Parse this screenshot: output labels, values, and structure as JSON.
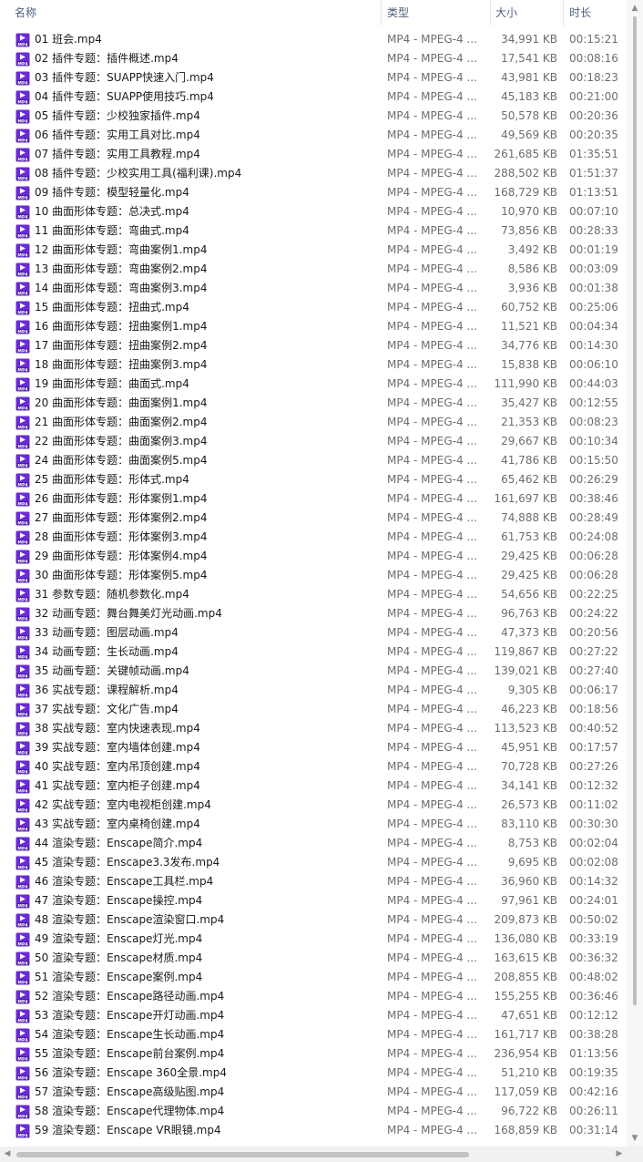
{
  "columns": {
    "name": "名称",
    "type": "类型",
    "size": "大小",
    "duration": "时长"
  },
  "icon": "mp4-file-icon",
  "icon_label": "MP4",
  "icon_color": "#6a2bd6",
  "files": [
    {
      "name": "01 班会.mp4",
      "type": "MP4 - MPEG-4 ...",
      "size": "34,991 KB",
      "duration": "00:15:21"
    },
    {
      "name": "02 插件专题：插件概述.mp4",
      "type": "MP4 - MPEG-4 ...",
      "size": "17,541 KB",
      "duration": "00:08:16"
    },
    {
      "name": "03 插件专题：SUAPP快速入门.mp4",
      "type": "MP4 - MPEG-4 ...",
      "size": "43,981 KB",
      "duration": "00:18:23"
    },
    {
      "name": "04 插件专题：SUAPP使用技巧.mp4",
      "type": "MP4 - MPEG-4 ...",
      "size": "45,183 KB",
      "duration": "00:21:00"
    },
    {
      "name": "05 插件专题：少校独家插件.mp4",
      "type": "MP4 - MPEG-4 ...",
      "size": "50,578 KB",
      "duration": "00:20:36"
    },
    {
      "name": "06 插件专题：实用工具对比.mp4",
      "type": "MP4 - MPEG-4 ...",
      "size": "49,569 KB",
      "duration": "00:20:35"
    },
    {
      "name": "07 插件专题：实用工具教程.mp4",
      "type": "MP4 - MPEG-4 ...",
      "size": "261,685 KB",
      "duration": "01:35:51"
    },
    {
      "name": "08 插件专题：少校实用工具(福利课).mp4",
      "type": "MP4 - MPEG-4 ...",
      "size": "288,502 KB",
      "duration": "01:51:37"
    },
    {
      "name": "09 插件专题：模型轻量化.mp4",
      "type": "MP4 - MPEG-4 ...",
      "size": "168,729 KB",
      "duration": "01:13:51"
    },
    {
      "name": "10 曲面形体专题：总决式.mp4",
      "type": "MP4 - MPEG-4 ...",
      "size": "10,970 KB",
      "duration": "00:07:10"
    },
    {
      "name": "11 曲面形体专题：弯曲式.mp4",
      "type": "MP4 - MPEG-4 ...",
      "size": "73,856 KB",
      "duration": "00:28:33"
    },
    {
      "name": "12 曲面形体专题：弯曲案例1.mp4",
      "type": "MP4 - MPEG-4 ...",
      "size": "3,492 KB",
      "duration": "00:01:19"
    },
    {
      "name": "13 曲面形体专题：弯曲案例2.mp4",
      "type": "MP4 - MPEG-4 ...",
      "size": "8,586 KB",
      "duration": "00:03:09"
    },
    {
      "name": "14 曲面形体专题：弯曲案例3.mp4",
      "type": "MP4 - MPEG-4 ...",
      "size": "3,936 KB",
      "duration": "00:01:38"
    },
    {
      "name": "15 曲面形体专题：扭曲式.mp4",
      "type": "MP4 - MPEG-4 ...",
      "size": "60,752 KB",
      "duration": "00:25:06"
    },
    {
      "name": "16 曲面形体专题：扭曲案例1.mp4",
      "type": "MP4 - MPEG-4 ...",
      "size": "11,521 KB",
      "duration": "00:04:34"
    },
    {
      "name": "17 曲面形体专题：扭曲案例2.mp4",
      "type": "MP4 - MPEG-4 ...",
      "size": "34,776 KB",
      "duration": "00:14:30"
    },
    {
      "name": "18 曲面形体专题：扭曲案例3.mp4",
      "type": "MP4 - MPEG-4 ...",
      "size": "15,838 KB",
      "duration": "00:06:10"
    },
    {
      "name": "19 曲面形体专题：曲面式.mp4",
      "type": "MP4 - MPEG-4 ...",
      "size": "111,990 KB",
      "duration": "00:44:03"
    },
    {
      "name": "20 曲面形体专题：曲面案例1.mp4",
      "type": "MP4 - MPEG-4 ...",
      "size": "35,427 KB",
      "duration": "00:12:55"
    },
    {
      "name": "21 曲面形体专题：曲面案例2.mp4",
      "type": "MP4 - MPEG-4 ...",
      "size": "21,353 KB",
      "duration": "00:08:23"
    },
    {
      "name": "22 曲面形体专题：曲面案例3.mp4",
      "type": "MP4 - MPEG-4 ...",
      "size": "29,667 KB",
      "duration": "00:10:34"
    },
    {
      "name": "24 曲面形体专题：曲面案例5.mp4",
      "type": "MP4 - MPEG-4 ...",
      "size": "41,786 KB",
      "duration": "00:15:50"
    },
    {
      "name": "25 曲面形体专题：形体式.mp4",
      "type": "MP4 - MPEG-4 ...",
      "size": "65,462 KB",
      "duration": "00:26:29"
    },
    {
      "name": "26 曲面形体专题：形体案例1.mp4",
      "type": "MP4 - MPEG-4 ...",
      "size": "161,697 KB",
      "duration": "00:38:46"
    },
    {
      "name": "27 曲面形体专题：形体案例2.mp4",
      "type": "MP4 - MPEG-4 ...",
      "size": "74,888 KB",
      "duration": "00:28:49"
    },
    {
      "name": "28 曲面形体专题：形体案例3.mp4",
      "type": "MP4 - MPEG-4 ...",
      "size": "61,753 KB",
      "duration": "00:24:08"
    },
    {
      "name": "29 曲面形体专题：形体案例4.mp4",
      "type": "MP4 - MPEG-4 ...",
      "size": "29,425 KB",
      "duration": "00:06:28"
    },
    {
      "name": "30 曲面形体专题：形体案例5.mp4",
      "type": "MP4 - MPEG-4 ...",
      "size": "29,425 KB",
      "duration": "00:06:28"
    },
    {
      "name": "31 参数专题：随机参数化.mp4",
      "type": "MP4 - MPEG-4 ...",
      "size": "54,656 KB",
      "duration": "00:22:25"
    },
    {
      "name": "32 动画专题：舞台舞美灯光动画.mp4",
      "type": "MP4 - MPEG-4 ...",
      "size": "96,763 KB",
      "duration": "00:24:22"
    },
    {
      "name": "33 动画专题：图层动画.mp4",
      "type": "MP4 - MPEG-4 ...",
      "size": "47,373 KB",
      "duration": "00:20:56"
    },
    {
      "name": "34 动画专题：生长动画.mp4",
      "type": "MP4 - MPEG-4 ...",
      "size": "119,867 KB",
      "duration": "00:27:22"
    },
    {
      "name": "35 动画专题：关键帧动画.mp4",
      "type": "MP4 - MPEG-4 ...",
      "size": "139,021 KB",
      "duration": "00:27:40"
    },
    {
      "name": "36 实战专题：课程解析.mp4",
      "type": "MP4 - MPEG-4 ...",
      "size": "9,305 KB",
      "duration": "00:06:17"
    },
    {
      "name": "37 实战专题：文化广告.mp4",
      "type": "MP4 - MPEG-4 ...",
      "size": "46,223 KB",
      "duration": "00:18:56"
    },
    {
      "name": "38 实战专题：室内快速表现.mp4",
      "type": "MP4 - MPEG-4 ...",
      "size": "113,523 KB",
      "duration": "00:40:52"
    },
    {
      "name": "39 实战专题：室内墙体创建.mp4",
      "type": "MP4 - MPEG-4 ...",
      "size": "45,951 KB",
      "duration": "00:17:57"
    },
    {
      "name": "40 实战专题：室内吊顶创建.mp4",
      "type": "MP4 - MPEG-4 ...",
      "size": "70,728 KB",
      "duration": "00:27:26"
    },
    {
      "name": "41 实战专题：室内柜子创建.mp4",
      "type": "MP4 - MPEG-4 ...",
      "size": "34,141 KB",
      "duration": "00:12:32"
    },
    {
      "name": "42 实战专题：室内电视柜创建.mp4",
      "type": "MP4 - MPEG-4 ...",
      "size": "26,573 KB",
      "duration": "00:11:02"
    },
    {
      "name": "43 实战专题：室内桌椅创建.mp4",
      "type": "MP4 - MPEG-4 ...",
      "size": "83,110 KB",
      "duration": "00:30:30"
    },
    {
      "name": "44 渲染专题：Enscape简介.mp4",
      "type": "MP4 - MPEG-4 ...",
      "size": "8,753 KB",
      "duration": "00:02:04"
    },
    {
      "name": "45 渲染专题：Enscape3.3发布.mp4",
      "type": "MP4 - MPEG-4 ...",
      "size": "9,695 KB",
      "duration": "00:02:08"
    },
    {
      "name": "46 渲染专题：Enscape工具栏.mp4",
      "type": "MP4 - MPEG-4 ...",
      "size": "36,960 KB",
      "duration": "00:14:32"
    },
    {
      "name": "47 渲染专题：Enscape操控.mp4",
      "type": "MP4 - MPEG-4 ...",
      "size": "97,961 KB",
      "duration": "00:24:01"
    },
    {
      "name": "48 渲染专题：Enscape渲染窗口.mp4",
      "type": "MP4 - MPEG-4 ...",
      "size": "209,873 KB",
      "duration": "00:50:02"
    },
    {
      "name": "49 渲染专题：Enscape灯光.mp4",
      "type": "MP4 - MPEG-4 ...",
      "size": "136,080 KB",
      "duration": "00:33:19"
    },
    {
      "name": "50 渲染专题：Enscape材质.mp4",
      "type": "MP4 - MPEG-4 ...",
      "size": "163,615 KB",
      "duration": "00:36:32"
    },
    {
      "name": "51 渲染专题：Enscape案例.mp4",
      "type": "MP4 - MPEG-4 ...",
      "size": "208,855 KB",
      "duration": "00:48:02"
    },
    {
      "name": "52 渲染专题：Enscape路径动画.mp4",
      "type": "MP4 - MPEG-4 ...",
      "size": "155,255 KB",
      "duration": "00:36:46"
    },
    {
      "name": "53 渲染专题：Enscape开灯动画.mp4",
      "type": "MP4 - MPEG-4 ...",
      "size": "47,651 KB",
      "duration": "00:12:12"
    },
    {
      "name": "54 渲染专题：Enscape生长动画.mp4",
      "type": "MP4 - MPEG-4 ...",
      "size": "161,717 KB",
      "duration": "00:38:28"
    },
    {
      "name": "55 渲染专题：Enscape前台案例.mp4",
      "type": "MP4 - MPEG-4 ...",
      "size": "236,954 KB",
      "duration": "01:13:56"
    },
    {
      "name": "56 渲染专题：Enscape 360全景.mp4",
      "type": "MP4 - MPEG-4 ...",
      "size": "51,210 KB",
      "duration": "00:19:35"
    },
    {
      "name": "57 渲染专题：Enscape高级贴图.mp4",
      "type": "MP4 - MPEG-4 ...",
      "size": "117,059 KB",
      "duration": "00:42:16"
    },
    {
      "name": "58 渲染专题：Enscape代理物体.mp4",
      "type": "MP4 - MPEG-4 ...",
      "size": "96,722 KB",
      "duration": "00:26:11"
    },
    {
      "name": "59 渲染专题：Enscape VR眼镜.mp4",
      "type": "MP4 - MPEG-4 ...",
      "size": "168,859 KB",
      "duration": "00:31:14"
    }
  ]
}
